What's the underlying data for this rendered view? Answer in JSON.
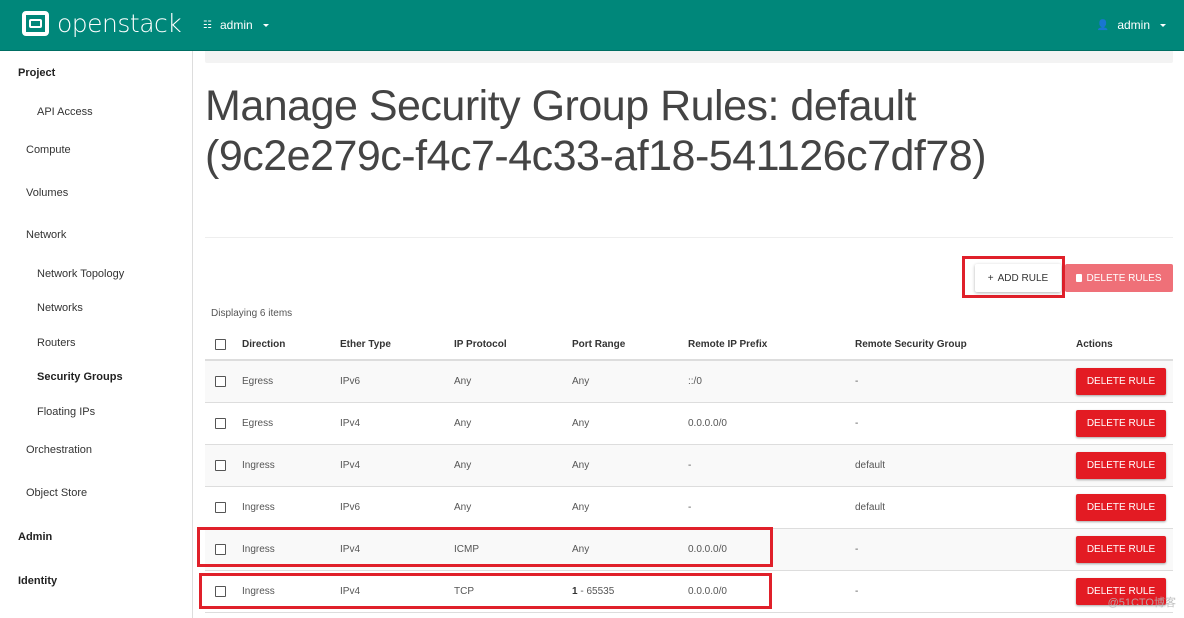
{
  "header": {
    "brand": "openstack",
    "project_menu": {
      "icon": "list-icon",
      "label": "admin"
    },
    "user_menu": {
      "icon": "user-icon",
      "label": "admin"
    }
  },
  "sidebar": {
    "items": [
      {
        "label": "Project",
        "level": 1
      },
      {
        "label": "API Access",
        "level": 3
      },
      {
        "label": "Compute",
        "level": 2
      },
      {
        "label": "Volumes",
        "level": 2
      },
      {
        "label": "Network",
        "level": 2
      },
      {
        "label": "Network Topology",
        "level": 3
      },
      {
        "label": "Networks",
        "level": 3
      },
      {
        "label": "Routers",
        "level": 3
      },
      {
        "label": "Security Groups",
        "level": 3,
        "active": true
      },
      {
        "label": "Floating IPs",
        "level": 3
      },
      {
        "label": "Orchestration",
        "level": 2
      },
      {
        "label": "Object Store",
        "level": 2
      },
      {
        "label": "Admin",
        "level": 1
      },
      {
        "label": "Identity",
        "level": 1
      }
    ]
  },
  "main": {
    "title": "Manage Security Group Rules: default (9c2e279c-f4c7-4c33-af18-541126c7df78)",
    "add_rule_label": "ADD RULE",
    "add_rule_icon": "plus-icon",
    "delete_rules_label": "DELETE RULES",
    "delete_rules_icon": "trash-icon",
    "count_text": "Displaying 6 items",
    "table": {
      "columns": [
        "Direction",
        "Ether Type",
        "IP Protocol",
        "Port Range",
        "Remote IP Prefix",
        "Remote Security Group",
        "Actions"
      ],
      "rows": [
        {
          "direction": "Egress",
          "ether_type": "IPv6",
          "ip_protocol": "Any",
          "port_range": "Any",
          "remote_ip_prefix": "::/0",
          "remote_security_group": "-",
          "action": "DELETE RULE"
        },
        {
          "direction": "Egress",
          "ether_type": "IPv4",
          "ip_protocol": "Any",
          "port_range": "Any",
          "remote_ip_prefix": "0.0.0.0/0",
          "remote_security_group": "-",
          "action": "DELETE RULE"
        },
        {
          "direction": "Ingress",
          "ether_type": "IPv4",
          "ip_protocol": "Any",
          "port_range": "Any",
          "remote_ip_prefix": "-",
          "remote_security_group": "default",
          "action": "DELETE RULE"
        },
        {
          "direction": "Ingress",
          "ether_type": "IPv6",
          "ip_protocol": "Any",
          "port_range": "Any",
          "remote_ip_prefix": "-",
          "remote_security_group": "default",
          "action": "DELETE RULE"
        },
        {
          "direction": "Ingress",
          "ether_type": "IPv4",
          "ip_protocol": "ICMP",
          "port_range": "Any",
          "remote_ip_prefix": "0.0.0.0/0",
          "remote_security_group": "-",
          "action": "DELETE RULE"
        },
        {
          "direction": "Ingress",
          "ether_type": "IPv4",
          "ip_protocol": "TCP",
          "port_range": "1 - 65535",
          "remote_ip_prefix": "0.0.0.0/0",
          "remote_security_group": "-",
          "action": "DELETE RULE"
        }
      ]
    }
  },
  "annotations": {
    "highlight_color": "#e0202a"
  },
  "watermark": "@51CTO博客"
}
